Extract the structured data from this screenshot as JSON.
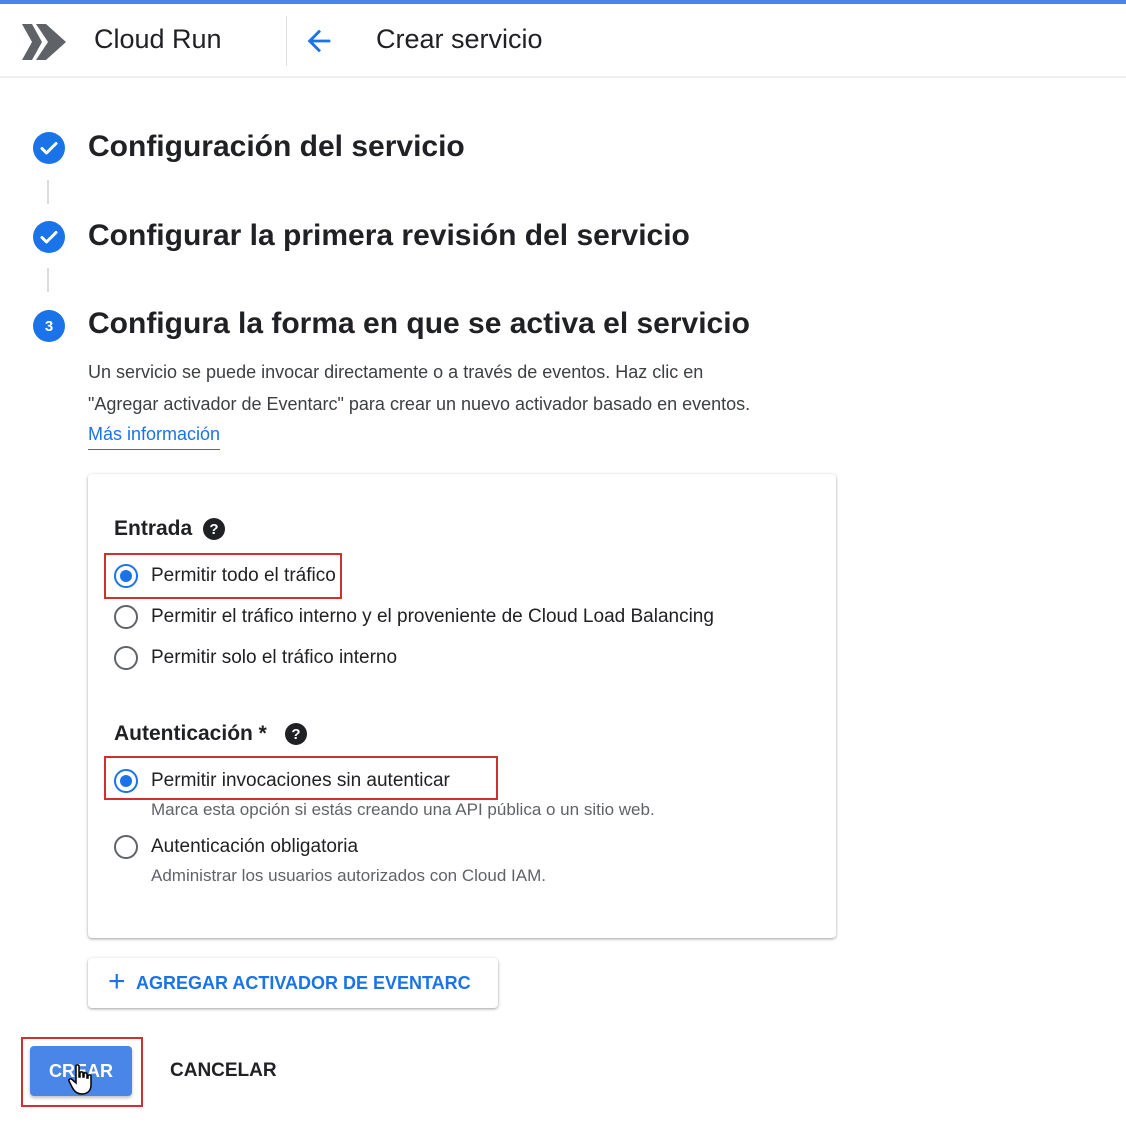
{
  "header": {
    "app_title": "Cloud Run",
    "page_title": "Crear servicio"
  },
  "steps": [
    {
      "title": "Configuración del servicio",
      "status": "completed"
    },
    {
      "title": "Configurar la primera revisión del servicio",
      "status": "completed"
    },
    {
      "title": "Configura la forma en que se activa el servicio",
      "status": "active",
      "number": "3"
    }
  ],
  "step3": {
    "description_line1": "Un servicio se puede invocar directamente o a través de eventos. Haz clic en",
    "description_line2": "\"Agregar activador de Eventarc\" para crear un nuevo activador basado en eventos.",
    "learn_more_link": "Más información"
  },
  "ingress": {
    "label": "Entrada",
    "options": [
      {
        "label": "Permitir todo el tráfico",
        "selected": true
      },
      {
        "label": "Permitir el tráfico interno y el proveniente de Cloud Load Balancing",
        "selected": false
      },
      {
        "label": "Permitir solo el tráfico interno",
        "selected": false
      }
    ]
  },
  "auth": {
    "label": "Autenticación *",
    "options": [
      {
        "label": "Permitir invocaciones sin autenticar",
        "sublabel": "Marca esta opción si estás creando una API pública o un sitio web.",
        "selected": true
      },
      {
        "label": "Autenticación obligatoria",
        "sublabel": "Administrar los usuarios autorizados con Cloud IAM.",
        "selected": false
      }
    ]
  },
  "add_trigger_button": "AGREGAR ACTIVADOR DE EVENTARC",
  "actions": {
    "create": "CREAR",
    "cancel": "CANCELAR"
  },
  "colors": {
    "accent": "#1a73e8",
    "primary_button": "#4a86e8",
    "highlight": "#d32f2f"
  },
  "icons": [
    "cloud-run-logo-icon",
    "arrow-back-icon",
    "check-circle-icon",
    "help-icon",
    "plus-icon",
    "hand-cursor-icon"
  ]
}
